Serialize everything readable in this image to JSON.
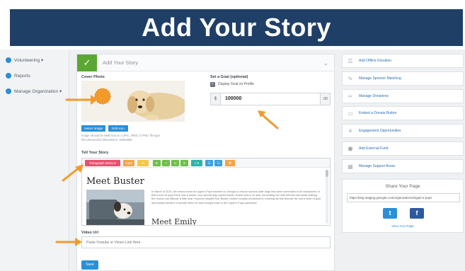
{
  "banner": {
    "title": "Add Your Story"
  },
  "sidebar": {
    "items": [
      {
        "label": "Volunteering ▾"
      },
      {
        "label": "Reports"
      },
      {
        "label": "Manage Organization ▾"
      }
    ]
  },
  "section": {
    "title": "Add Your Story"
  },
  "cover": {
    "label": "Cover Photo",
    "select_label": "Select Image",
    "edit_label": "Edit Icon",
    "note1": "Image should be 5MB max in a JPG, JPEG or PNG file type.",
    "note2": "Recommended dimensions: 1500x800"
  },
  "goal": {
    "label": "Set a Goal (optional)",
    "checkbox_label": "Display Goal on Profile",
    "currency": "$",
    "value": "100000",
    "cents": ".00"
  },
  "story": {
    "label": "Tell Your Story",
    "toolbar": {
      "paragraph": "Paragraph Menu ▾",
      "style1": "14px",
      "style2": "A",
      "bold": "B",
      "italic": "I",
      "underline": "U",
      "strike": "S",
      "align": "≡ ▾",
      "list1": "☰",
      "list2": "☷",
      "link": "⌘"
    },
    "heading": "Meet Buster",
    "body": "In March of 2015, the rescue team at Logan's Pups traveled to Georgia to rescue several older dogs who were scheduled to be euthanized. In that bunch of pups there was a sweet, very special dog named Buster. Buster was a 10 year old bulldog mix with arthritis that made walking the rescue van difficult. A little bear. However despite this, Buster couldn't contain excitement in meeting his first friends! He had a heart of gold and quickly became a favorite when he was brought back to the Logan's Pups sanctuary.",
    "subheading": "Meet Emily"
  },
  "video": {
    "label": "Video Url",
    "placeholder": "Paste Youtube or Vimeo Link Here"
  },
  "save_label": "Save",
  "right_panel": {
    "items": [
      {
        "icon": "☰",
        "label": "Add Offline Donation"
      },
      {
        "icon": "✎",
        "label": "Manage Sponsor Matching"
      },
      {
        "icon": "✂",
        "label": "Manage Donations"
      },
      {
        "icon": "▭",
        "label": "Embed a Donate Button"
      },
      {
        "icon": "⚘",
        "label": "Engagement Opportunities"
      },
      {
        "icon": "⬟",
        "label": "Add External Fund"
      },
      {
        "icon": "▦",
        "label": "Manage Support Areas"
      }
    ],
    "share": {
      "title": "Share Your Page",
      "url": "https://dog-staging.givegab.com/organizations/logan-s-pups",
      "twitter": "t",
      "facebook": "f",
      "view_link": "View Your Page"
    }
  },
  "colors": {
    "banner": "#1f3f66",
    "accent_green": "#5aa832",
    "accent_blue": "#2a8fd6",
    "arrow_orange": "#f39a2b",
    "toolbar_pink": "#e8516e",
    "toolbar_orange": "#f2a54a",
    "toolbar_yellow": "#f2c84a",
    "toolbar_green": "#6fbf4a",
    "toolbar_teal": "#2fb3a8",
    "toolbar_blue": "#3aa0e0",
    "twitter": "#2a8fd6",
    "facebook": "#2d5a9c"
  }
}
